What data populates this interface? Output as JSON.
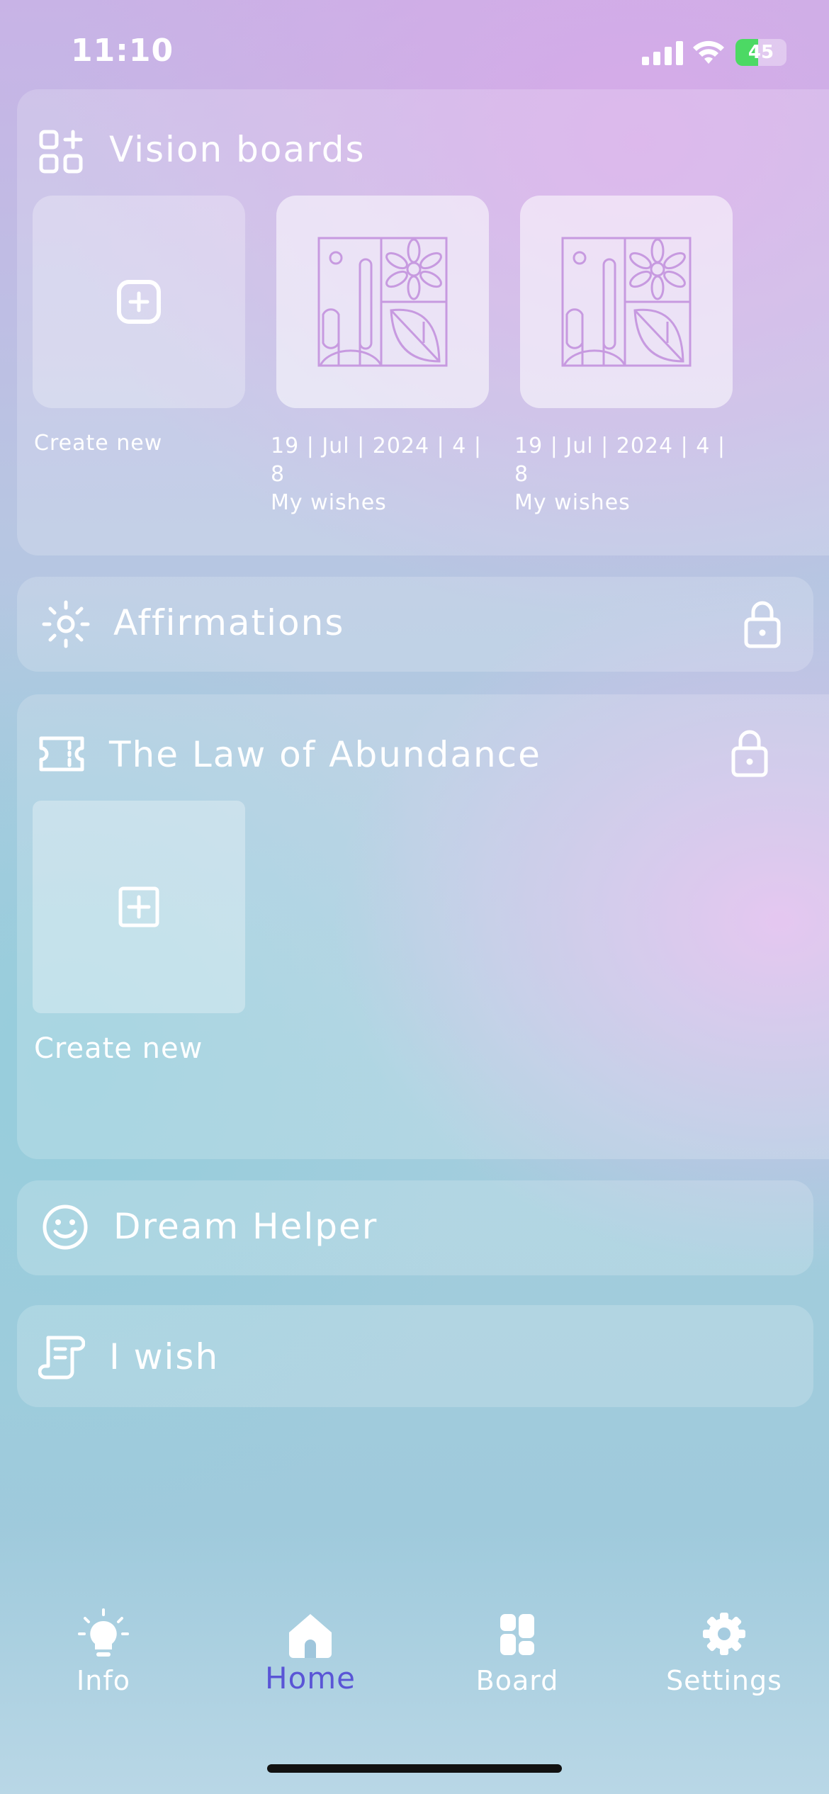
{
  "status_bar": {
    "time": "11:10",
    "battery": "45"
  },
  "vision_boards": {
    "title": "Vision boards",
    "tiles": [
      {
        "label": "Create new"
      },
      {
        "date": "19 | Jul | 2024 | 4 | 8",
        "name": "My wishes"
      },
      {
        "date": "19 | Jul | 2024 | 4 | 8",
        "name": "My wishes"
      }
    ]
  },
  "affirmations": {
    "title": "Affirmations"
  },
  "law_of_abundance": {
    "title": "The Law of Abundance",
    "create_label": "Create new"
  },
  "dream_helper": {
    "title": "Dream Helper"
  },
  "i_wish": {
    "title": "I wish"
  },
  "tabs": [
    {
      "label": "Info",
      "icon": "lightbulb-icon"
    },
    {
      "label": "Home",
      "icon": "home-icon",
      "active": true
    },
    {
      "label": "Board",
      "icon": "board-icon"
    },
    {
      "label": "Settings",
      "icon": "gear-icon"
    }
  ],
  "colors": {
    "active_tab": "#5a55d6",
    "board_line": "#c79ae0"
  }
}
